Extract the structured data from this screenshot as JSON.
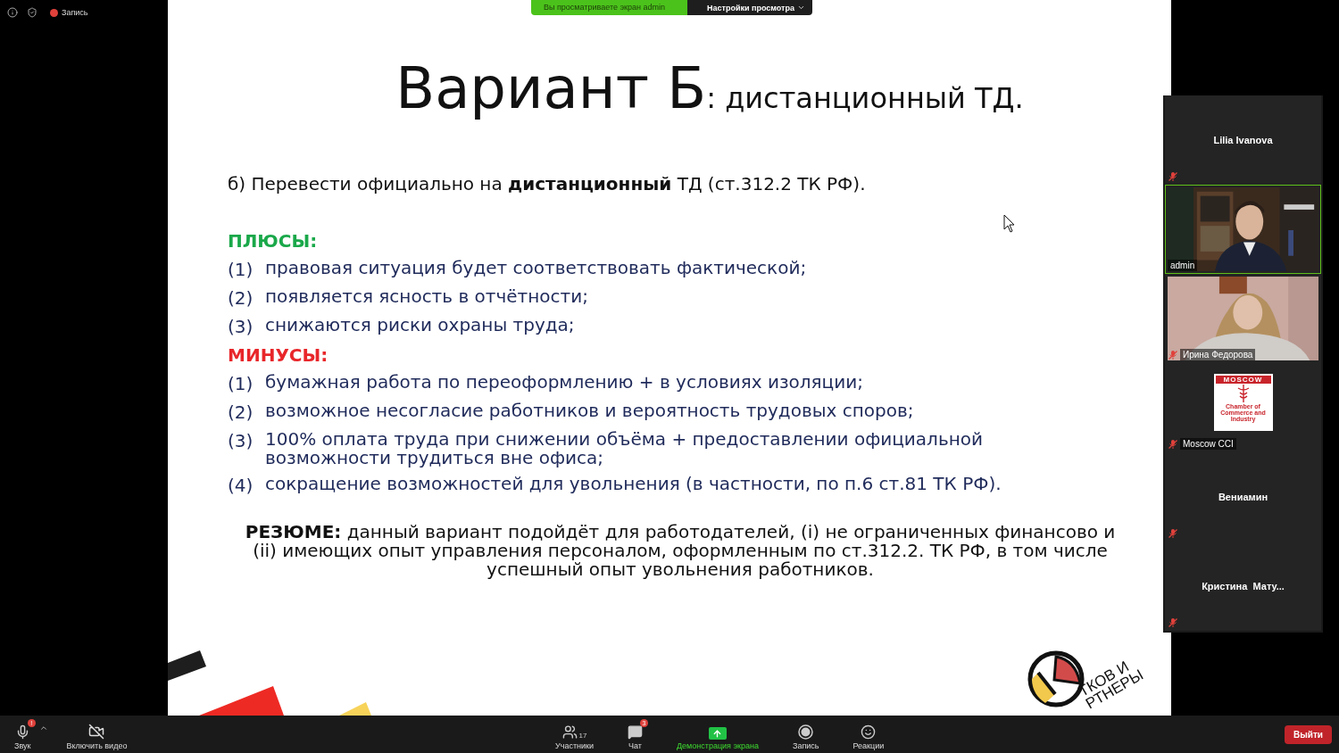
{
  "top_bar": {
    "record_label": "Запись",
    "recording": true
  },
  "share_banner": {
    "status": "Вы просматриваете экран admin",
    "settings_button": "Настройки просмотра"
  },
  "slide": {
    "title_main": "Вариант Б",
    "title_sub": ": дистанционный ТД.",
    "intro": "б) Перевести официально на **дистанционный** ТД (ст.312.2 ТК РФ).",
    "sections": [
      {
        "kind": "pros",
        "heading": "ПЛЮСЫ:",
        "items": [
          {
            "number": "(1)",
            "text": "правовая ситуация будет соответствовать фактической;"
          },
          {
            "number": "(2)",
            "text": "появляется ясность в отчётности;"
          },
          {
            "number": "(3)",
            "text": "снижаются риски охраны труда;"
          }
        ]
      },
      {
        "kind": "cons",
        "heading": "МИНУСЫ:",
        "items": [
          {
            "number": "(1)",
            "text": "бумажная работа по переоформлению + в условиях изоляции;"
          },
          {
            "number": "(2)",
            "text": "возможное несогласие работников и вероятность трудовых споров;"
          },
          {
            "number": "(3)",
            "text": "100% оплата труда при снижении объёма + предоставлении официальной возможности трудиться вне офиса;"
          },
          {
            "number": "(4)",
            "text": "сокращение возможностей для увольнения (в частности, по п.6 ст.81 ТК РФ)."
          }
        ]
      }
    ],
    "summary": "**РЕЗЮМЕ:**  данный вариант подойдёт для работодателей, (i) не ограниченных финансово и (ii) имеющих опыт управления персоналом, оформленным по ст.312.2. ТК РФ, в том числе успешный опыт увольнения работников.",
    "logo_lines": [
      "ТКОВ И",
      "РТНЕРЫ"
    ]
  },
  "participants": [
    {
      "kind": "name",
      "name": "Lilia Ivanova",
      "muted": true,
      "speaking": false
    },
    {
      "kind": "video",
      "name": "admin",
      "muted": false,
      "speaking": true
    },
    {
      "kind": "video",
      "name": "Ирина Федорова",
      "muted": true,
      "speaking": false
    },
    {
      "kind": "logo",
      "name": "Moscow CCI",
      "muted": true,
      "speaking": false,
      "logo_texts": [
        "MOSCOW",
        "Chamber of Commerce and Industry"
      ]
    },
    {
      "kind": "name",
      "name": "Вениамин",
      "muted": true,
      "speaking": false
    },
    {
      "kind": "name",
      "name": "Кристина  Мату...",
      "muted": true,
      "speaking": false
    }
  ],
  "toolbar": {
    "left": [
      {
        "kind": "audio",
        "label": "Звук",
        "alert": "!"
      },
      {
        "kind": "video",
        "label": "Включить видео"
      }
    ],
    "center": [
      {
        "kind": "participants",
        "label": "Участники",
        "count": "17"
      },
      {
        "kind": "chat",
        "label": "Чат",
        "badge": "3"
      },
      {
        "kind": "share",
        "label": "Демонстрация экрана"
      },
      {
        "kind": "record",
        "label": "Запись"
      },
      {
        "kind": "reactions",
        "label": "Реакции"
      }
    ],
    "leave_button": "Выйти"
  }
}
